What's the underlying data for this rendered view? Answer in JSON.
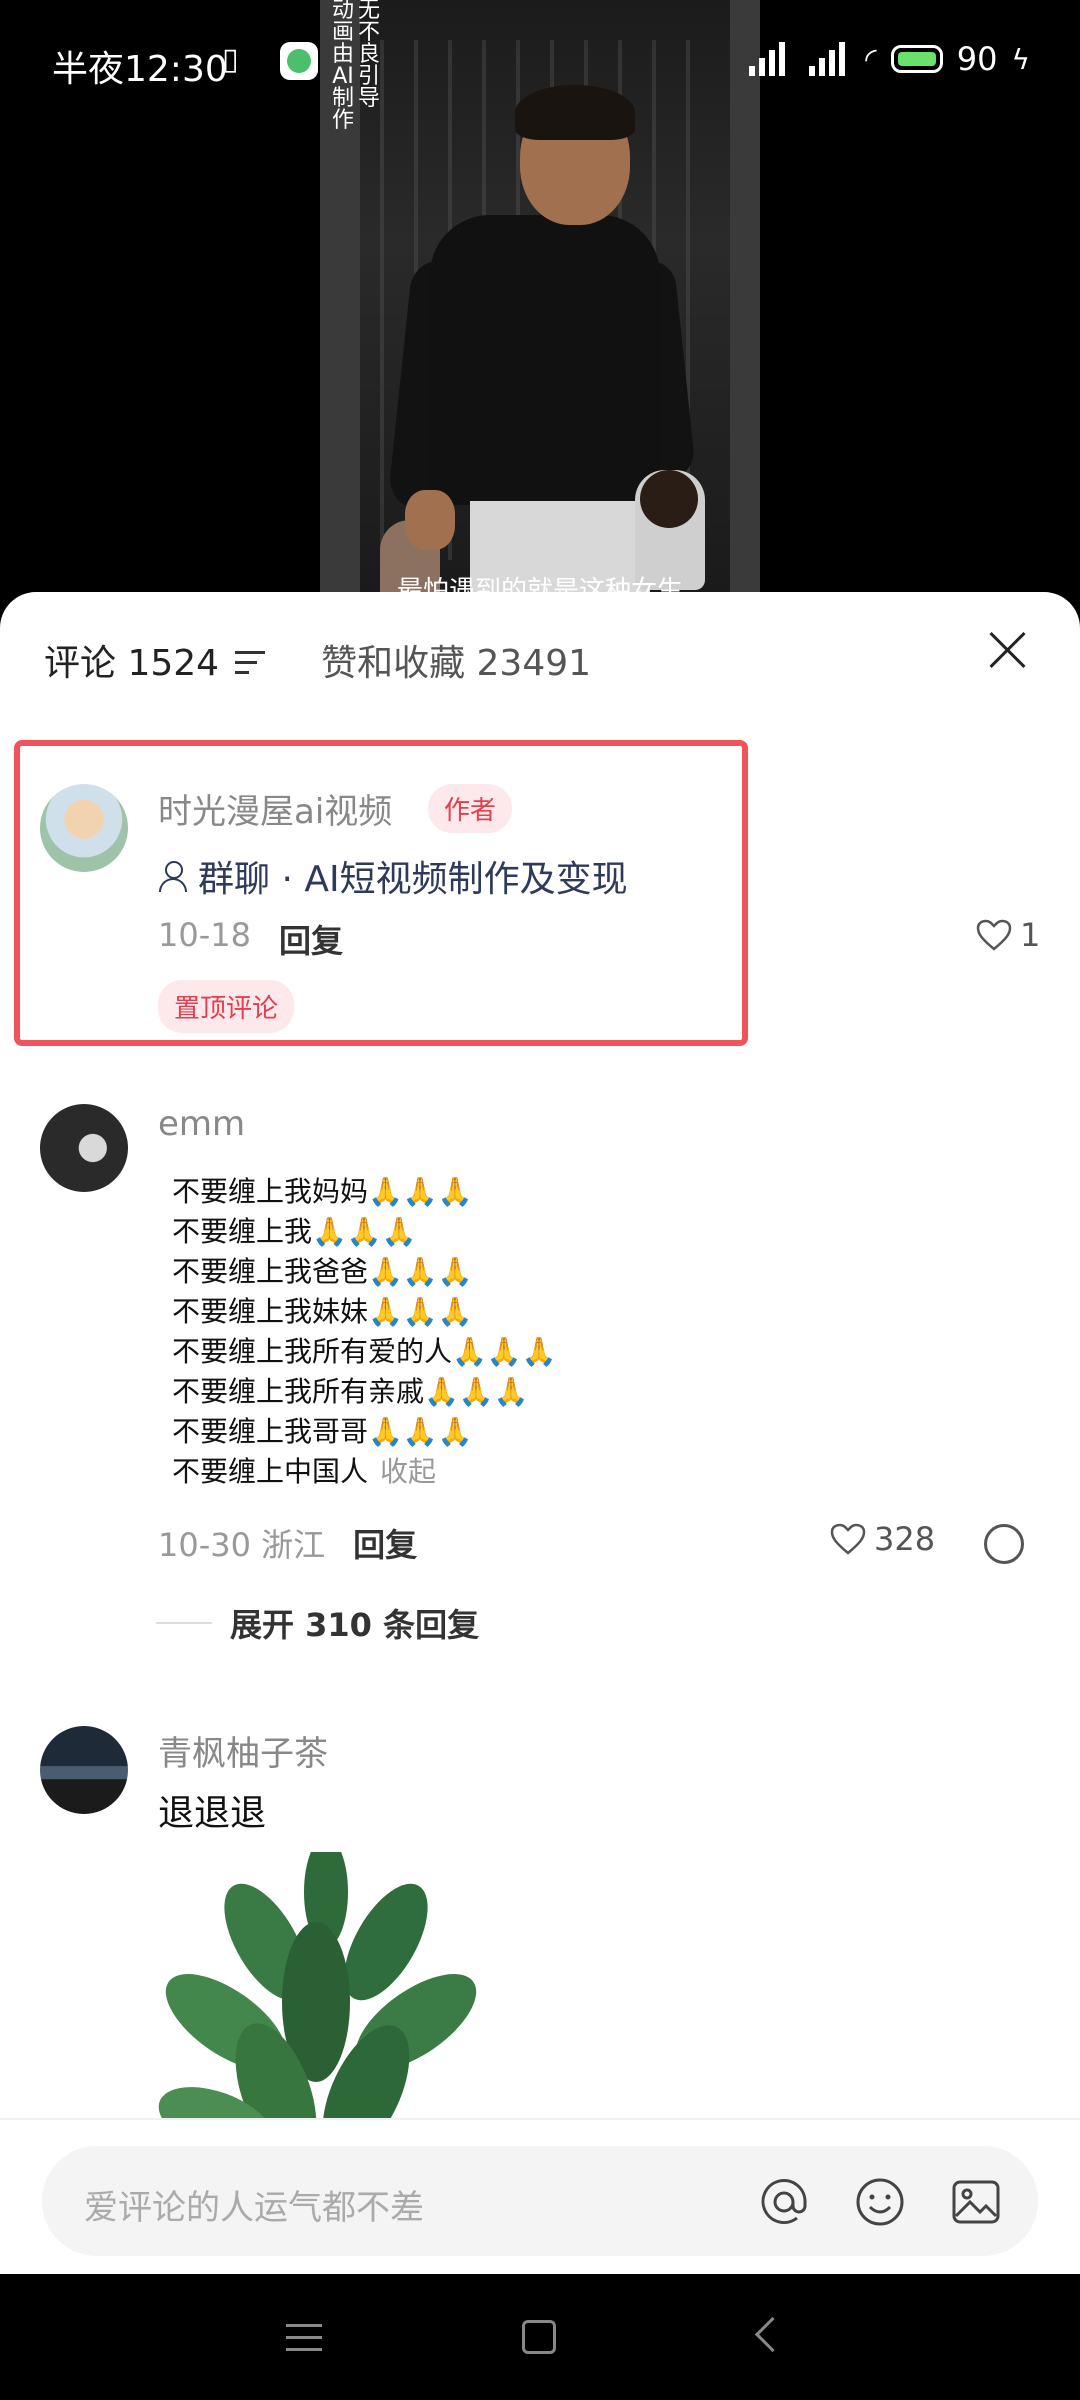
{
  "status_bar": {
    "time": "半夜12:30",
    "battery": "90"
  },
  "video": {
    "vertical_text_1": "无不良引导",
    "vertical_text_2": "动画由AI制作",
    "subtitle": "最怕遇到的就是这种女生"
  },
  "sheet": {
    "comments_tab": "评论 1524",
    "likes_tab": "赞和收藏 23491"
  },
  "comments": [
    {
      "name": "时光漫屋ai视频",
      "badge": "作者",
      "group_label": "群聊 · AI短视频制作及变现",
      "date": "10-18",
      "reply": "回复",
      "likes": "1",
      "pinned": "置顶评论"
    },
    {
      "name": "emm",
      "lines": [
        "不要缠上我妈妈🙏🙏🙏",
        "不要缠上我🙏🙏🙏",
        "不要缠上我爸爸🙏🙏🙏",
        "不要缠上我妹妹🙏🙏🙏",
        "不要缠上我所有爱的人🙏🙏🙏",
        "不要缠上我所有亲戚🙏🙏🙏",
        "不要缠上我哥哥🙏🙏🙏",
        "不要缠上中国人"
      ],
      "collapse": "收起",
      "date": "10-30 浙江",
      "reply": "回复",
      "likes": "328",
      "expand": "展开 310 条回复"
    },
    {
      "name": "青枫柚子茶",
      "text": "退退退"
    }
  ],
  "input": {
    "placeholder": "爱评论的人运气都不差"
  },
  "colors": {
    "highlight_border": "#f0545a",
    "badge_red": "#e53e4d",
    "group_link": "#2d3a5a"
  }
}
